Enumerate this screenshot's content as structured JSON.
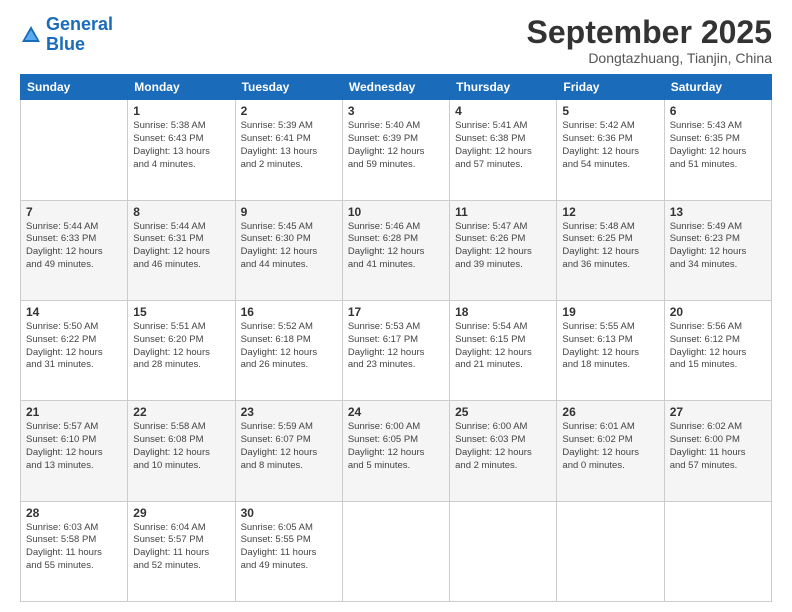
{
  "logo": {
    "line1": "General",
    "line2": "Blue"
  },
  "header": {
    "month": "September 2025",
    "location": "Dongtazhuang, Tianjin, China"
  },
  "columns": [
    "Sunday",
    "Monday",
    "Tuesday",
    "Wednesday",
    "Thursday",
    "Friday",
    "Saturday"
  ],
  "weeks": [
    [
      {
        "day": "",
        "info": ""
      },
      {
        "day": "1",
        "info": "Sunrise: 5:38 AM\nSunset: 6:43 PM\nDaylight: 13 hours\nand 4 minutes."
      },
      {
        "day": "2",
        "info": "Sunrise: 5:39 AM\nSunset: 6:41 PM\nDaylight: 13 hours\nand 2 minutes."
      },
      {
        "day": "3",
        "info": "Sunrise: 5:40 AM\nSunset: 6:39 PM\nDaylight: 12 hours\nand 59 minutes."
      },
      {
        "day": "4",
        "info": "Sunrise: 5:41 AM\nSunset: 6:38 PM\nDaylight: 12 hours\nand 57 minutes."
      },
      {
        "day": "5",
        "info": "Sunrise: 5:42 AM\nSunset: 6:36 PM\nDaylight: 12 hours\nand 54 minutes."
      },
      {
        "day": "6",
        "info": "Sunrise: 5:43 AM\nSunset: 6:35 PM\nDaylight: 12 hours\nand 51 minutes."
      }
    ],
    [
      {
        "day": "7",
        "info": "Sunrise: 5:44 AM\nSunset: 6:33 PM\nDaylight: 12 hours\nand 49 minutes."
      },
      {
        "day": "8",
        "info": "Sunrise: 5:44 AM\nSunset: 6:31 PM\nDaylight: 12 hours\nand 46 minutes."
      },
      {
        "day": "9",
        "info": "Sunrise: 5:45 AM\nSunset: 6:30 PM\nDaylight: 12 hours\nand 44 minutes."
      },
      {
        "day": "10",
        "info": "Sunrise: 5:46 AM\nSunset: 6:28 PM\nDaylight: 12 hours\nand 41 minutes."
      },
      {
        "day": "11",
        "info": "Sunrise: 5:47 AM\nSunset: 6:26 PM\nDaylight: 12 hours\nand 39 minutes."
      },
      {
        "day": "12",
        "info": "Sunrise: 5:48 AM\nSunset: 6:25 PM\nDaylight: 12 hours\nand 36 minutes."
      },
      {
        "day": "13",
        "info": "Sunrise: 5:49 AM\nSunset: 6:23 PM\nDaylight: 12 hours\nand 34 minutes."
      }
    ],
    [
      {
        "day": "14",
        "info": "Sunrise: 5:50 AM\nSunset: 6:22 PM\nDaylight: 12 hours\nand 31 minutes."
      },
      {
        "day": "15",
        "info": "Sunrise: 5:51 AM\nSunset: 6:20 PM\nDaylight: 12 hours\nand 28 minutes."
      },
      {
        "day": "16",
        "info": "Sunrise: 5:52 AM\nSunset: 6:18 PM\nDaylight: 12 hours\nand 26 minutes."
      },
      {
        "day": "17",
        "info": "Sunrise: 5:53 AM\nSunset: 6:17 PM\nDaylight: 12 hours\nand 23 minutes."
      },
      {
        "day": "18",
        "info": "Sunrise: 5:54 AM\nSunset: 6:15 PM\nDaylight: 12 hours\nand 21 minutes."
      },
      {
        "day": "19",
        "info": "Sunrise: 5:55 AM\nSunset: 6:13 PM\nDaylight: 12 hours\nand 18 minutes."
      },
      {
        "day": "20",
        "info": "Sunrise: 5:56 AM\nSunset: 6:12 PM\nDaylight: 12 hours\nand 15 minutes."
      }
    ],
    [
      {
        "day": "21",
        "info": "Sunrise: 5:57 AM\nSunset: 6:10 PM\nDaylight: 12 hours\nand 13 minutes."
      },
      {
        "day": "22",
        "info": "Sunrise: 5:58 AM\nSunset: 6:08 PM\nDaylight: 12 hours\nand 10 minutes."
      },
      {
        "day": "23",
        "info": "Sunrise: 5:59 AM\nSunset: 6:07 PM\nDaylight: 12 hours\nand 8 minutes."
      },
      {
        "day": "24",
        "info": "Sunrise: 6:00 AM\nSunset: 6:05 PM\nDaylight: 12 hours\nand 5 minutes."
      },
      {
        "day": "25",
        "info": "Sunrise: 6:00 AM\nSunset: 6:03 PM\nDaylight: 12 hours\nand 2 minutes."
      },
      {
        "day": "26",
        "info": "Sunrise: 6:01 AM\nSunset: 6:02 PM\nDaylight: 12 hours\nand 0 minutes."
      },
      {
        "day": "27",
        "info": "Sunrise: 6:02 AM\nSunset: 6:00 PM\nDaylight: 11 hours\nand 57 minutes."
      }
    ],
    [
      {
        "day": "28",
        "info": "Sunrise: 6:03 AM\nSunset: 5:58 PM\nDaylight: 11 hours\nand 55 minutes."
      },
      {
        "day": "29",
        "info": "Sunrise: 6:04 AM\nSunset: 5:57 PM\nDaylight: 11 hours\nand 52 minutes."
      },
      {
        "day": "30",
        "info": "Sunrise: 6:05 AM\nSunset: 5:55 PM\nDaylight: 11 hours\nand 49 minutes."
      },
      {
        "day": "",
        "info": ""
      },
      {
        "day": "",
        "info": ""
      },
      {
        "day": "",
        "info": ""
      },
      {
        "day": "",
        "info": ""
      }
    ]
  ]
}
